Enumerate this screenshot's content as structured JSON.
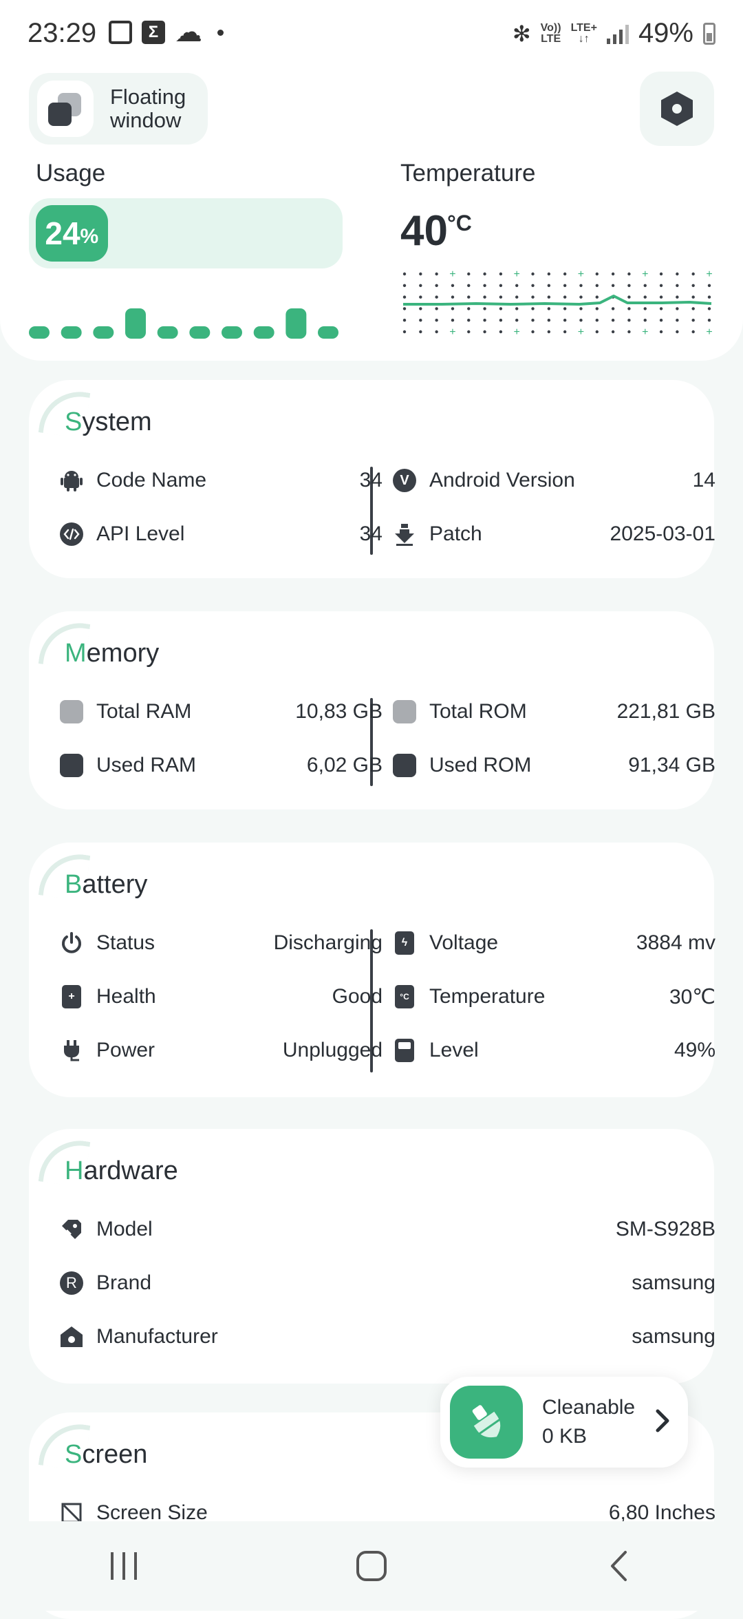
{
  "status_bar": {
    "time": "23:29",
    "net_top": "Vo))",
    "net_bottom": "LTE",
    "lte_top": "LTE+",
    "battery": "49%"
  },
  "header": {
    "floating_window_label": "Floating window",
    "usage": {
      "title": "Usage",
      "value": "24",
      "unit": "%",
      "fraction": 0.24,
      "history": [
        0.1,
        0.1,
        0.1,
        0.55,
        0.2,
        0.1,
        0.1,
        0.15,
        0.55,
        0.12
      ]
    },
    "temperature": {
      "title": "Temperature",
      "value": "40",
      "unit": "°C"
    }
  },
  "system": {
    "title_first": "S",
    "title_rest": "ystem",
    "code_name_label": "Code Name",
    "code_name_value": "34",
    "android_version_label": "Android Version",
    "android_version_value": "14",
    "api_level_label": "API Level",
    "api_level_value": "34",
    "patch_label": "Patch",
    "patch_value": "2025-03-01"
  },
  "memory": {
    "title_first": "M",
    "title_rest": "emory",
    "total_ram_label": "Total RAM",
    "total_ram_value": "10,83 GB",
    "total_rom_label": "Total ROM",
    "total_rom_value": "221,81 GB",
    "used_ram_label": "Used RAM",
    "used_ram_value": "6,02 GB",
    "used_rom_label": "Used ROM",
    "used_rom_value": "91,34 GB"
  },
  "battery": {
    "title_first": "B",
    "title_rest": "attery",
    "status_label": "Status",
    "status_value": "Discharging",
    "voltage_label": "Voltage",
    "voltage_value": "3884 mv",
    "health_label": "Health",
    "health_value": "Good",
    "temperature_label": "Temperature",
    "temperature_value": "30℃",
    "temp_icon_text": "°C",
    "power_label": "Power",
    "power_value": "Unplugged",
    "level_label": "Level",
    "level_value": "49%"
  },
  "hardware": {
    "title_first": "H",
    "title_rest": "ardware",
    "model_label": "Model",
    "model_value": "SM-S928B",
    "brand_label": "Brand",
    "brand_icon_text": "R",
    "brand_value": "samsung",
    "manufacturer_label": "Manufacturer",
    "manufacturer_value": "samsung"
  },
  "screen": {
    "title_first": "S",
    "title_rest": "creen",
    "screen_size_label": "Screen Size",
    "screen_size_value": "6,80 Inches"
  },
  "cleanable": {
    "label": "Cleanable",
    "value": "0 KB"
  },
  "android_version_icon_text": "V",
  "colors": {
    "accent": "#3bb47e",
    "accent_light": "#e4f5ee",
    "dark": "#3a3f46"
  }
}
